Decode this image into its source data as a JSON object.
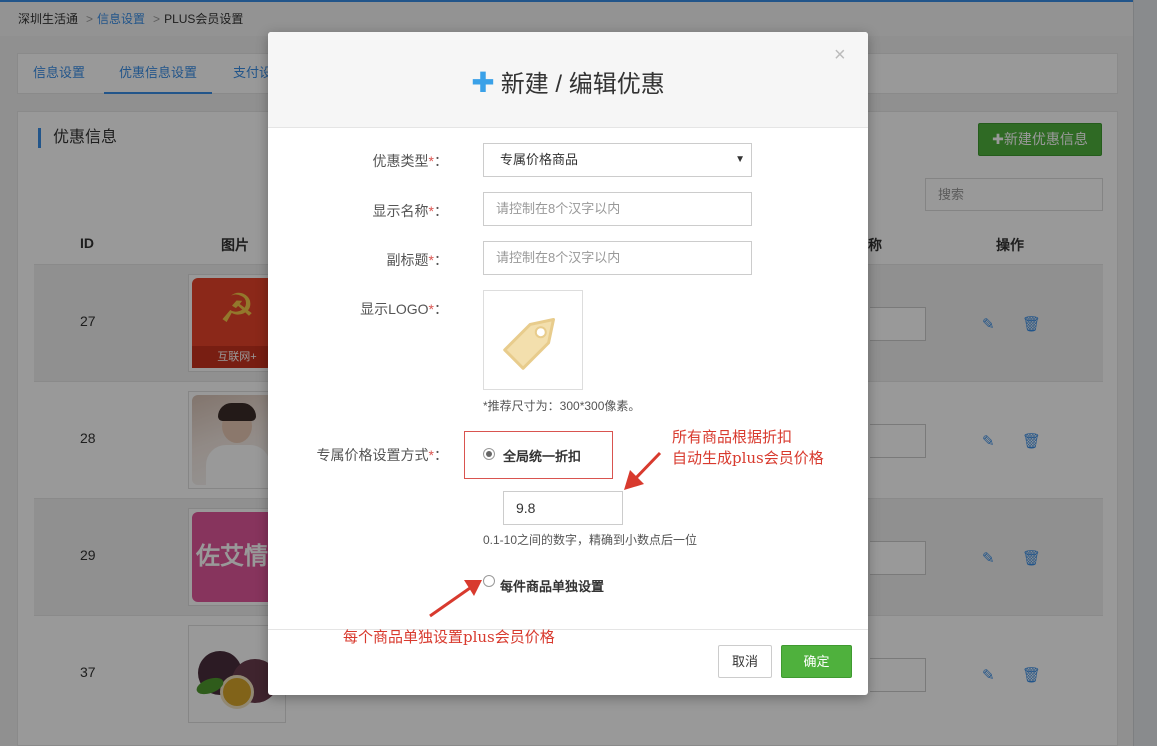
{
  "breadcrumb": {
    "home": "深圳生活通",
    "section": "信息设置",
    "current": "PLUS会员设置"
  },
  "tabs": [
    {
      "label": "信息设置"
    },
    {
      "label": "优惠信息设置"
    },
    {
      "label": "支付设"
    }
  ],
  "main": {
    "section_title": "优惠信息",
    "new_button": "✚新建优惠信息",
    "search_placeholder": "搜索",
    "headers": {
      "id": "ID",
      "image": "图片",
      "partial": "称",
      "actions": "操作"
    },
    "rows": [
      {
        "id": "27",
        "thumb_text": "互联网+"
      },
      {
        "id": "28"
      },
      {
        "id": "29",
        "thumb_text": "佐艾情趣"
      },
      {
        "id": "37"
      }
    ]
  },
  "modal": {
    "title": "新建 / 编辑优惠",
    "close": "×",
    "type_label": "优惠类型",
    "type_value": "专属价格商品",
    "name_label": "显示名称",
    "name_placeholder": "请控制在8个汉字以内",
    "subtitle_label": "副标题",
    "subtitle_placeholder": "请控制在8个汉字以内",
    "logo_label": "显示LOGO",
    "logo_hint": "*推荐尺寸为：300*300像素。",
    "price_mode_label": "专属价格设置方式",
    "option_uniform": "全局统一折扣",
    "option_uniform_selected": true,
    "discount_value": "9.8",
    "discount_hint": "0.1-10之间的数字，精确到小数点后一位",
    "option_each": "每件商品单独设置",
    "cancel_label": "取消",
    "ok_label": "确定",
    "required_mark": "*",
    "colon": "："
  },
  "annotations": {
    "uniform_note_line1": "所有商品根据折扣",
    "uniform_note_line2": "自动生成plus会员价格",
    "each_note": "每个商品单独设置plus会员价格"
  },
  "colors": {
    "accent": "#3a8ee6",
    "success": "#4fb13d",
    "annotation": "#d83a2e"
  }
}
